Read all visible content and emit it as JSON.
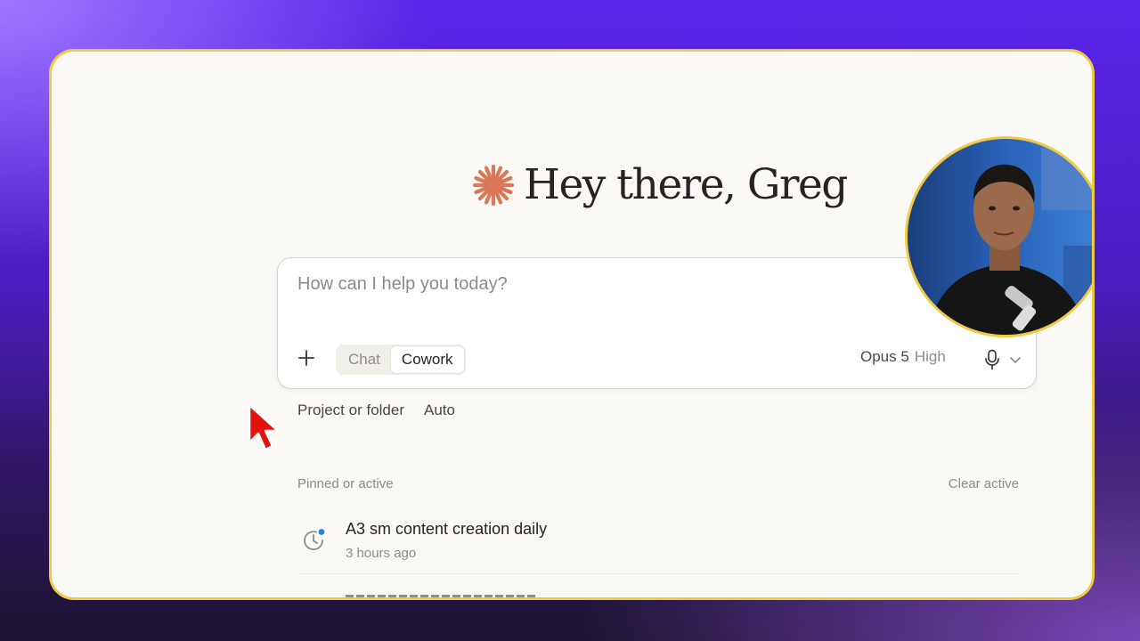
{
  "greeting": {
    "text": "Hey there, Greg",
    "accent_color": "#d97757"
  },
  "composer": {
    "placeholder": "How can I help you today?",
    "value": "",
    "modes": [
      {
        "label": "Chat",
        "active": false
      },
      {
        "label": "Cowork",
        "active": true
      }
    ],
    "model": "Opus 5",
    "effort": "High",
    "icons": {
      "add": "plus-icon",
      "mic": "microphone-icon",
      "dropdown": "chevron-down-icon"
    }
  },
  "options": {
    "project": "Project or folder",
    "mode": "Auto"
  },
  "pinned": {
    "heading": "Pinned or active",
    "clear_label": "Clear active",
    "items": [
      {
        "title": "A3 sm content creation daily",
        "time": "3 hours ago",
        "icon": "clock-icon",
        "status_color": "#2f7de1"
      }
    ]
  },
  "colors": {
    "frame_border": "#f1c944",
    "surface": "#faf9f6",
    "cursor": "#e3120b"
  }
}
